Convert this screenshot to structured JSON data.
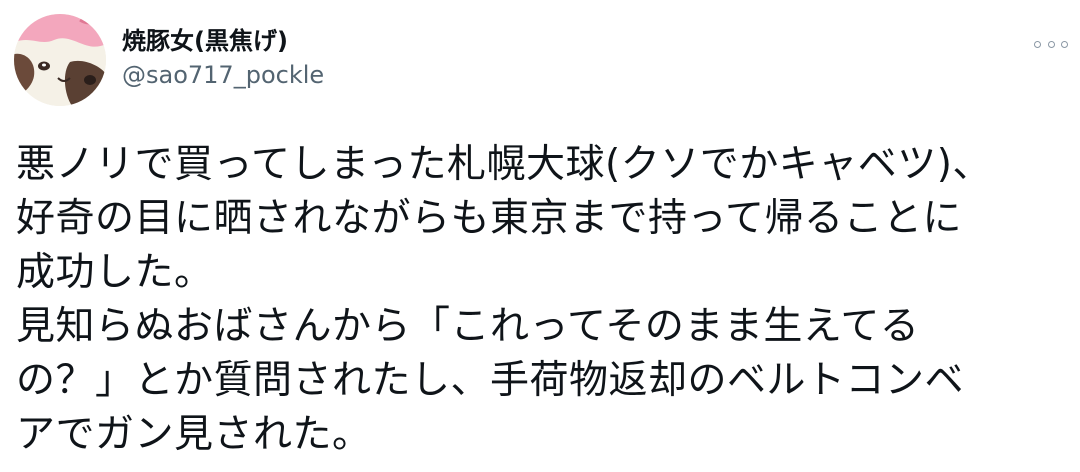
{
  "author": {
    "display_name": "焼豚女(黒焦げ)",
    "handle": "@sao717_pockle",
    "avatar_icon": "avatar-cat-icon"
  },
  "header": {
    "more_icon": "more-options-icon"
  },
  "tweet": {
    "lines": [
      "悪ノリで買ってしまった札幌大球(クソでかキャベツ)、",
      "好奇の目に晒されながらも東京まで持って帰ることに",
      "成功した。",
      "見知らぬおばさんから「これってそのまま生えてる",
      "の？」とか質問されたし、手荷物返却のベルトコンベ",
      "アでガン見された。"
    ]
  },
  "colors": {
    "text": "#0f1419",
    "secondary": "#536471",
    "avatar_pink": "#f3a7bd",
    "avatar_brown": "#5a4033"
  }
}
